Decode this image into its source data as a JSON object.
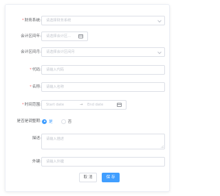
{
  "form": {
    "fields": [
      {
        "label": "财务系统:",
        "required": true,
        "placeholder": "请选择财务系统",
        "type": "select"
      },
      {
        "label": "会计区间年:",
        "required": false,
        "placeholder": "请选择会计区...",
        "type": "date"
      },
      {
        "label": "会计区间月:",
        "required": false,
        "placeholder": "请选择会计区间月",
        "type": "select"
      },
      {
        "label": "代码:",
        "required": true,
        "placeholder": "请输入代码",
        "type": "text"
      },
      {
        "label": "名称:",
        "required": true,
        "placeholder": "请输入名称",
        "type": "text"
      },
      {
        "label": "时间范围:",
        "required": true,
        "type": "daterange",
        "start_placeholder": "Start date",
        "separator": "→",
        "end_placeholder": "End date"
      },
      {
        "label": "是否是调整期:",
        "required": false,
        "type": "radio",
        "options": [
          "是",
          "否"
        ],
        "selected": "是"
      },
      {
        "label": "描述:",
        "required": false,
        "placeholder": "请输入描述",
        "type": "textarea"
      },
      {
        "label": "外键:",
        "required": false,
        "placeholder": "请输入外键",
        "type": "text"
      }
    ],
    "buttons": {
      "cancel": "取 消",
      "save": "保 存"
    }
  },
  "colors": {
    "primary": "#409eff",
    "required": "#f56c6c",
    "border": "#dcdfe6",
    "placeholder": "#c0c4cc"
  }
}
